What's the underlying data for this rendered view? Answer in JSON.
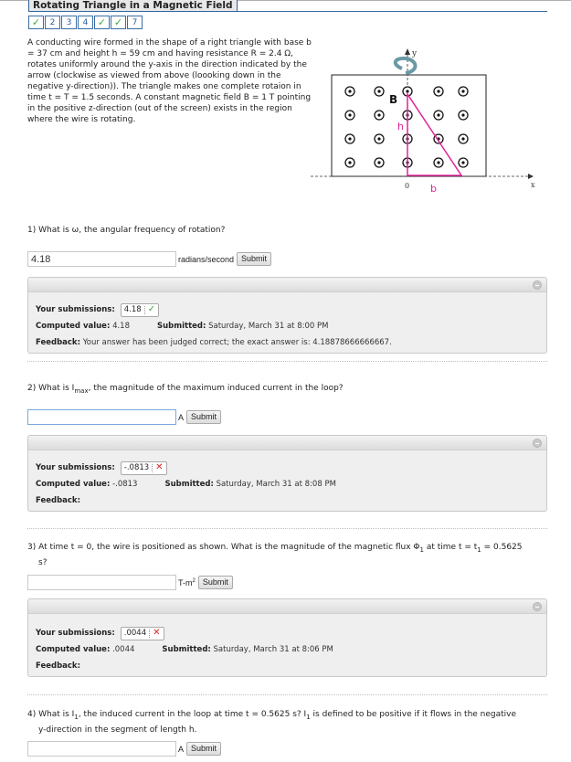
{
  "header": {
    "title": "Rotating Triangle in a Magnetic Field",
    "nav": [
      {
        "label": "",
        "status": "correct",
        "icon": "check-icon"
      },
      {
        "label": "2",
        "status": "open"
      },
      {
        "label": "3",
        "status": "open"
      },
      {
        "label": "4",
        "status": "open"
      },
      {
        "label": "",
        "status": "correct",
        "icon": "check-icon"
      },
      {
        "label": "",
        "status": "correct",
        "icon": "check-icon"
      },
      {
        "label": "7",
        "status": "open"
      }
    ]
  },
  "intro": "A conducting wire formed in the shape of a right triangle with base b = 37 cm and height h = 59 cm and having resistance R = 2.4 Ω, rotates uniformly around the y-axis in the direction indicated by the arrow (clockwise as viewed from above (loooking down in the negative y-direction)). The triangle makes one complete rotaion in time t = T = 1.5 seconds. A constant magnetic field B = 1 T pointing in the positive z-direction (out of the screen) exists in the region where the wire is rotating.",
  "figure": {
    "field_label": "B",
    "height_label": "h",
    "base_label": "b",
    "origin_label": "0",
    "x_axis_label": "x",
    "y_axis_label": "y",
    "triangle_color": "#e0249a"
  },
  "questions": [
    {
      "number": "1)",
      "text_before": "What is ω, the angular frequency of rotation?",
      "input_value": "4.18",
      "input_placeholder": "",
      "unit": "radians/second",
      "submit_label": "Submit",
      "panel": {
        "submissions_label": "Your submissions:",
        "submission_value": "4.18",
        "submission_status": "correct",
        "computed_label": "Computed value:",
        "computed_value": "4.18",
        "submitted_label": "Submitted:",
        "submitted_value": "Saturday, March 31 at 8:00 PM",
        "feedback_label": "Feedback:",
        "feedback_value": "Your answer has been judged correct; the exact answer is: 4.18878666666667."
      }
    },
    {
      "number": "2)",
      "text_before": "What is I",
      "text_sub": "max",
      "text_after": ", the magnitude of the maximum induced current in the loop?",
      "input_value": "",
      "unit": "A",
      "submit_label": "Submit",
      "panel": {
        "submissions_label": "Your submissions:",
        "submission_value": "-.0813",
        "submission_status": "incorrect",
        "computed_label": "Computed value:",
        "computed_value": "-.0813",
        "submitted_label": "Submitted:",
        "submitted_value": "Saturday, March 31 at 8:08 PM",
        "feedback_label": "Feedback:",
        "feedback_value": ""
      }
    },
    {
      "number": "3)",
      "text_before": "At time t = 0, the wire is positioned as shown. What is the magnitude of the magnetic flux Φ",
      "text_sub": "1",
      "text_after": " at time t = t",
      "text_sub2": "1",
      "text_after2": " = 0.5625",
      "text_line2": "s?",
      "input_value": "",
      "unit": "T-m",
      "unit_sup": "2",
      "submit_label": "Submit",
      "panel": {
        "submissions_label": "Your submissions:",
        "submission_value": ".0044",
        "submission_status": "incorrect",
        "computed_label": "Computed value:",
        "computed_value": ".0044",
        "submitted_label": "Submitted:",
        "submitted_value": "Saturday, March 31 at 8:06 PM",
        "feedback_label": "Feedback:",
        "feedback_value": ""
      }
    },
    {
      "number": "4)",
      "text_before": "What is I",
      "text_sub": "1",
      "text_after": ", the induced current in the loop at time t = 0.5625 s? I",
      "text_sub2": "1",
      "text_after2": " is defined to be positive if it flows in the negative",
      "text_line2": "y-direction in the segment of length h.",
      "input_value": "",
      "unit": "A",
      "submit_label": "Submit"
    }
  ]
}
